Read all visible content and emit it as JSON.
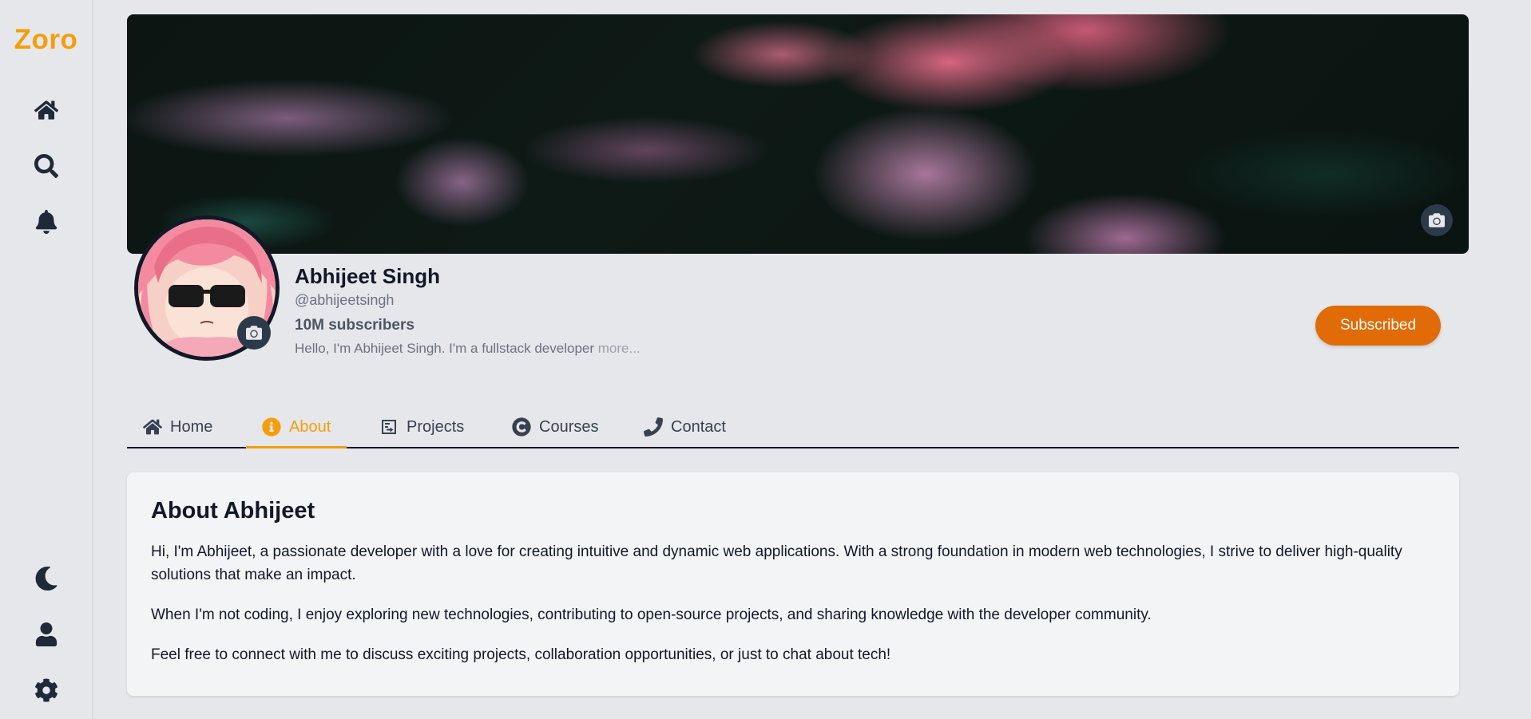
{
  "app": {
    "logo": "Zoro"
  },
  "sidebar": {
    "top_icons": [
      "home-icon",
      "search-icon",
      "bell-icon"
    ],
    "bottom_icons": [
      "moon-icon",
      "user-icon",
      "gear-icon"
    ]
  },
  "profile": {
    "name": "Abhijeet Singh",
    "handle": "@abhijeetsingh",
    "subscribers": "10M subscribers",
    "bio": "Hello, I'm Abhijeet Singh. I'm a fullstack developer",
    "more": "more...",
    "subscribe_label": "Subscribed"
  },
  "tabs": [
    {
      "label": "Home",
      "icon": "home-icon",
      "active": false
    },
    {
      "label": "About",
      "icon": "info-icon",
      "active": true
    },
    {
      "label": "Projects",
      "icon": "projects-icon",
      "active": false
    },
    {
      "label": "Courses",
      "icon": "courses-icon",
      "active": false
    },
    {
      "label": "Contact",
      "icon": "phone-icon",
      "active": false
    }
  ],
  "about": {
    "title": "About Abhijeet",
    "paragraphs": [
      "Hi, I'm Abhijeet, a passionate developer with a love for creating intuitive and dynamic web applications. With a strong foundation in modern web technologies, I strive to deliver high-quality solutions that make an impact.",
      "When I'm not coding, I enjoy exploring new technologies, contributing to open-source projects, and sharing knowledge with the developer community.",
      "Feel free to connect with me to discuss exciting projects, collaboration opportunities, or just to chat about tech!"
    ]
  },
  "colors": {
    "accent": "#f59e0b",
    "button": "#e06b07",
    "background": "#e5e7eb",
    "card": "#f3f4f6"
  }
}
